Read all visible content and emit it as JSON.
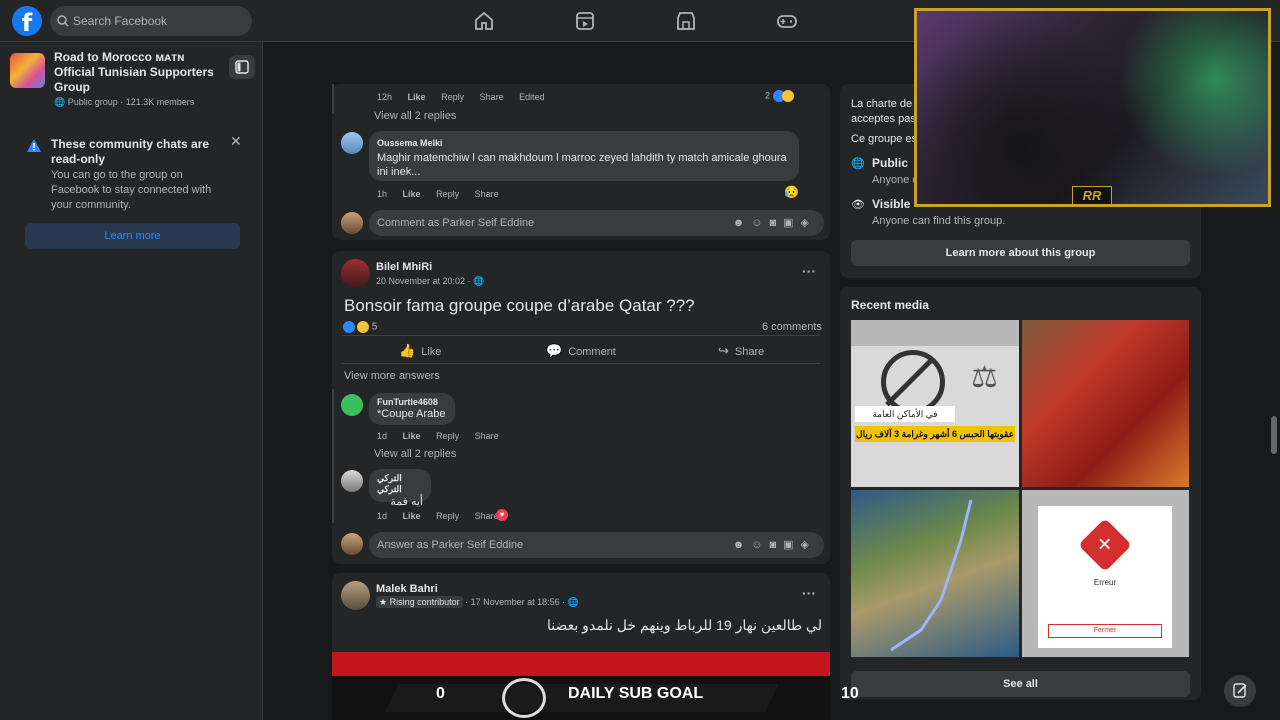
{
  "header": {
    "logo": "f",
    "search_placeholder": "Search Facebook"
  },
  "sidebar": {
    "group_name": "Road to Morocco ᴍᴀᴛɴ Official Tunisian Supporters Group",
    "group_meta": "Public group · 121.3K members",
    "notice_title": "These community chats are read-only",
    "notice_body": "You can go to the group on Facebook to stay connected with your community.",
    "learn_more": "Learn more"
  },
  "feed": {
    "top_comment": {
      "time": "12h",
      "like": "Like",
      "reply": "Reply",
      "share": "Share",
      "edited": "Edited",
      "reaction_count": "2",
      "view_replies": "View all 2 replies"
    },
    "comment_oussema": {
      "name": "Oussema Melki",
      "text": "Maghir matemchiw l can makhdoum l marroc zeyed lahdith ty match amicale ghoura ini inek...",
      "time": "1h",
      "like": "Like",
      "reply": "Reply",
      "share": "Share",
      "reaction": "😥"
    },
    "comment_input_1": "Comment as Parker Seif Eddine",
    "post_bilel": {
      "author": "Bilel MhiRi",
      "time": "20 November at 20:02 · 🌐",
      "text": "Bonsoir fama groupe coupe d’arabe Qatar ???",
      "reactions": "5",
      "comments": "6 comments",
      "like": "Like",
      "comment": "Comment",
      "share": "Share",
      "view_more": "View more answers"
    },
    "reply_funturtle": {
      "name": "FunTurtle4608",
      "text": "*Coupe Arabe",
      "time": "1d",
      "like": "Like",
      "reply": "Reply",
      "share": "Share",
      "view_replies": "View all 2 replies"
    },
    "reply_turki": {
      "name": "التركي التركي",
      "text": "أيه فمة",
      "time": "1d",
      "like": "Like",
      "reply": "Reply",
      "share": "Share"
    },
    "answer_input": "Answer as Parker Seif Eddine",
    "post_malek": {
      "author": "Malek Bahri",
      "badge": "Rising contributor",
      "time": "· 17 November at 18:56 · 🌐",
      "text": "لي طالعين نهار 19 للرباط وينهم خل نلمدو بعضنا"
    }
  },
  "about": {
    "charter": "La charte de",
    "accept": "acceptes pas",
    "group_is": "Ce groupe es",
    "public_title": "Public",
    "public_sub": "Anyone c",
    "visible_title": "Visible",
    "visible_sub": "Anyone can find this group.",
    "learn_more_btn": "Learn more about this group"
  },
  "recent_media": {
    "title": "Recent media",
    "see_all": "See all",
    "m1_caption": "في الأماكن العامة",
    "m1_banner": "عقوبتها الحبس 6 أشهر وغرامة 3 آلاف ريال",
    "m4_error_title": "Erreur",
    "m4_button": "Fermer"
  },
  "overlay": {
    "goal_left": "0",
    "goal_title": "DAILY SUB GOAL",
    "goal_right": "10",
    "webcam_logo": "RR"
  }
}
